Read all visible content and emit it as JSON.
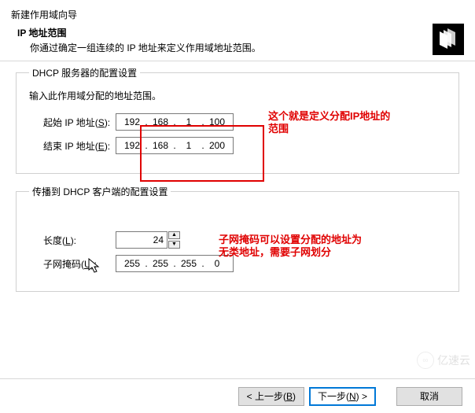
{
  "header": {
    "window_title": "新建作用域向导",
    "subtitle": "IP 地址范围",
    "description": "你通过确定一组连续的 IP 地址来定义作用域地址范围。"
  },
  "group1": {
    "legend": "DHCP 服务器的配置设置",
    "desc": "输入此作用域分配的地址范围。",
    "start": {
      "label_pre": "起始 IP 地址(",
      "label_key": "S",
      "label_post": "):",
      "o1": "192",
      "o2": "168",
      "o3": "1",
      "o4": "100"
    },
    "end": {
      "label_pre": "结束 IP 地址(",
      "label_key": "E",
      "label_post": "):",
      "o1": "192",
      "o2": "168",
      "o3": "1",
      "o4": "200"
    }
  },
  "group2": {
    "legend": "传播到 DHCP 客户端的配置设置",
    "length": {
      "label_pre": "长度(",
      "label_key": "L",
      "label_post": "):",
      "value": "24"
    },
    "mask": {
      "label_pre": "子网掩码(",
      "label_key": "U",
      "label_post": "):",
      "o1": "255",
      "o2": "255",
      "o3": "255",
      "o4": "0"
    }
  },
  "annotations": {
    "a1_line1": "这个就是定义分配IP地址的",
    "a1_line2": "范围",
    "a2_line1": "子网掩码可以设置分配的地址为",
    "a2_line2": "无类地址，需要子网划分"
  },
  "footer": {
    "back_pre": "< 上一步(",
    "back_key": "B",
    "back_post": ")",
    "next_pre": "下一步(",
    "next_key": "N",
    "next_post": ") >",
    "cancel": "取消"
  },
  "watermark": "亿速云"
}
